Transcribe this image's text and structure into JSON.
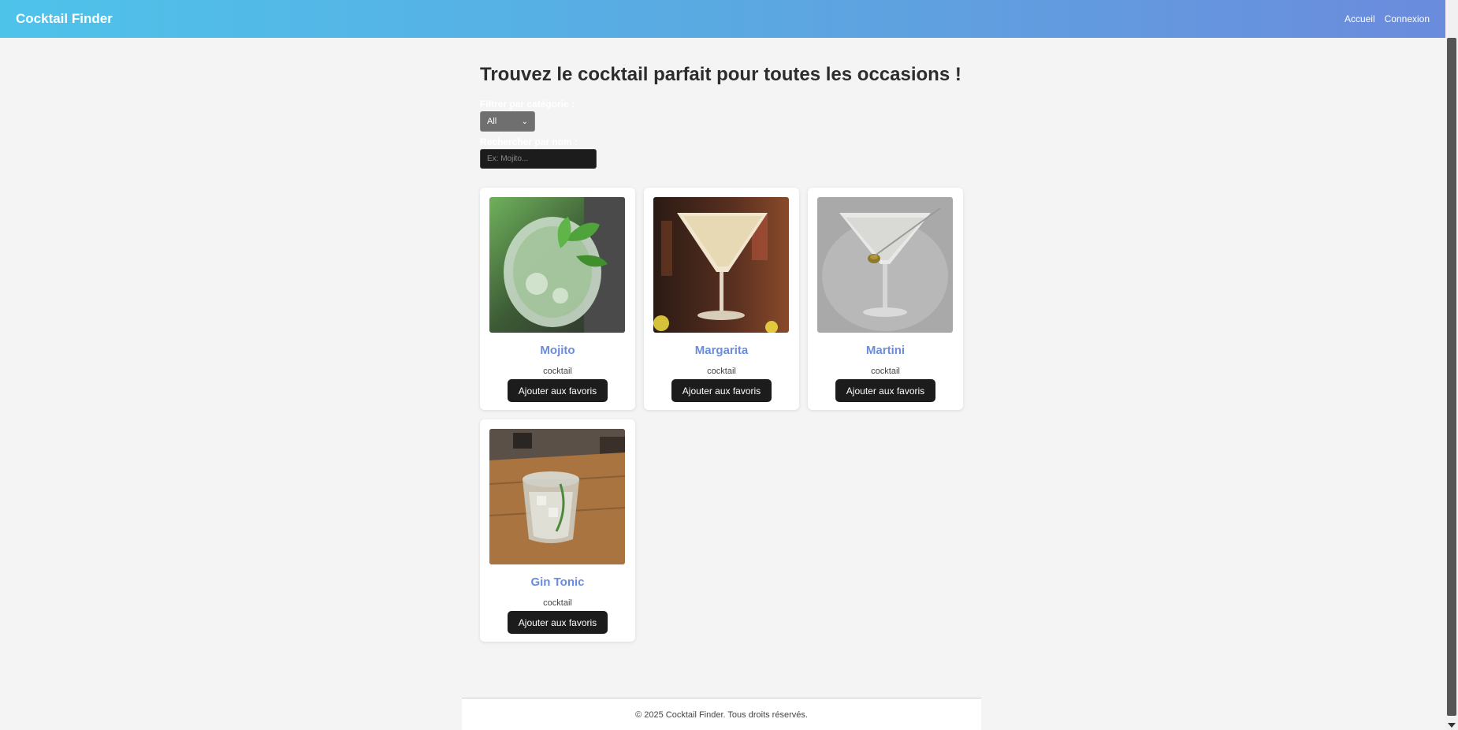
{
  "nav": {
    "brand": "Cocktail Finder",
    "links": [
      "Accueil",
      "Connexion"
    ]
  },
  "main": {
    "title": "Trouvez le cocktail parfait pour toutes les occasions !",
    "filter_label": "Filtrer par catégorie :",
    "category_value": "All",
    "search_label": "Rechercher par nom :",
    "search_placeholder": "Ex: Mojito..."
  },
  "cocktails": [
    {
      "name": "Mojito",
      "category": "cocktail",
      "button": "Ajouter aux favoris"
    },
    {
      "name": "Margarita",
      "category": "cocktail",
      "button": "Ajouter aux favoris"
    },
    {
      "name": "Martini",
      "category": "cocktail",
      "button": "Ajouter aux favoris"
    },
    {
      "name": "Gin Tonic",
      "category": "cocktail",
      "button": "Ajouter aux favoris"
    }
  ],
  "footer": {
    "text": "© 2025 Cocktail Finder. Tous droits réservés."
  },
  "colors": {
    "accent": "#6b8bdc",
    "button_bg": "#1c1c1c",
    "page_bg": "#f4f4f4"
  }
}
